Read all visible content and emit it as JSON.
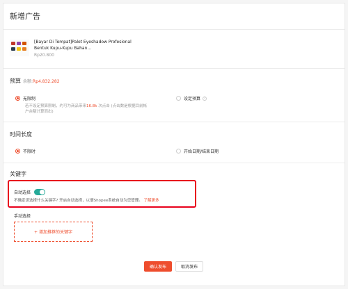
{
  "page": {
    "title": "新增广告"
  },
  "product": {
    "name": "[Bayar Di Tempat]Palet Eyeshadow Profesional Bentuk Kupu-Kupu Bahan...",
    "price": "Rp20.800"
  },
  "budget": {
    "title": "预算",
    "balance_label": "余额:",
    "balance_value": "Rp4.832.282",
    "option_unlimited": "无限制",
    "option_set": "设定预算",
    "hint_before": "若不设定预算限制，约可为商品带来",
    "hint_value": "16.8k",
    "hint_after": " 次点击 (点击数是根据目前帐户余额计算而出)"
  },
  "duration": {
    "title": "时间长度",
    "option_unlimited": "不限时",
    "option_range": "开始日期/结束日期"
  },
  "keywords": {
    "title": "关键字",
    "auto_label": "自动选择",
    "auto_desc": "不确定该选择什么关键字? 开启自动选择，以便Shopee系统自动为您管理。",
    "learn_more": "了解更多",
    "manual_label": "手动选择",
    "add_button": "+ 增加推荐的关键字"
  },
  "actions": {
    "confirm": "确认发布",
    "cancel": "取消发布"
  },
  "colors": {
    "accent": "#ee4d2d",
    "toggle_on": "#26aa99",
    "highlight": "#e8001c"
  }
}
